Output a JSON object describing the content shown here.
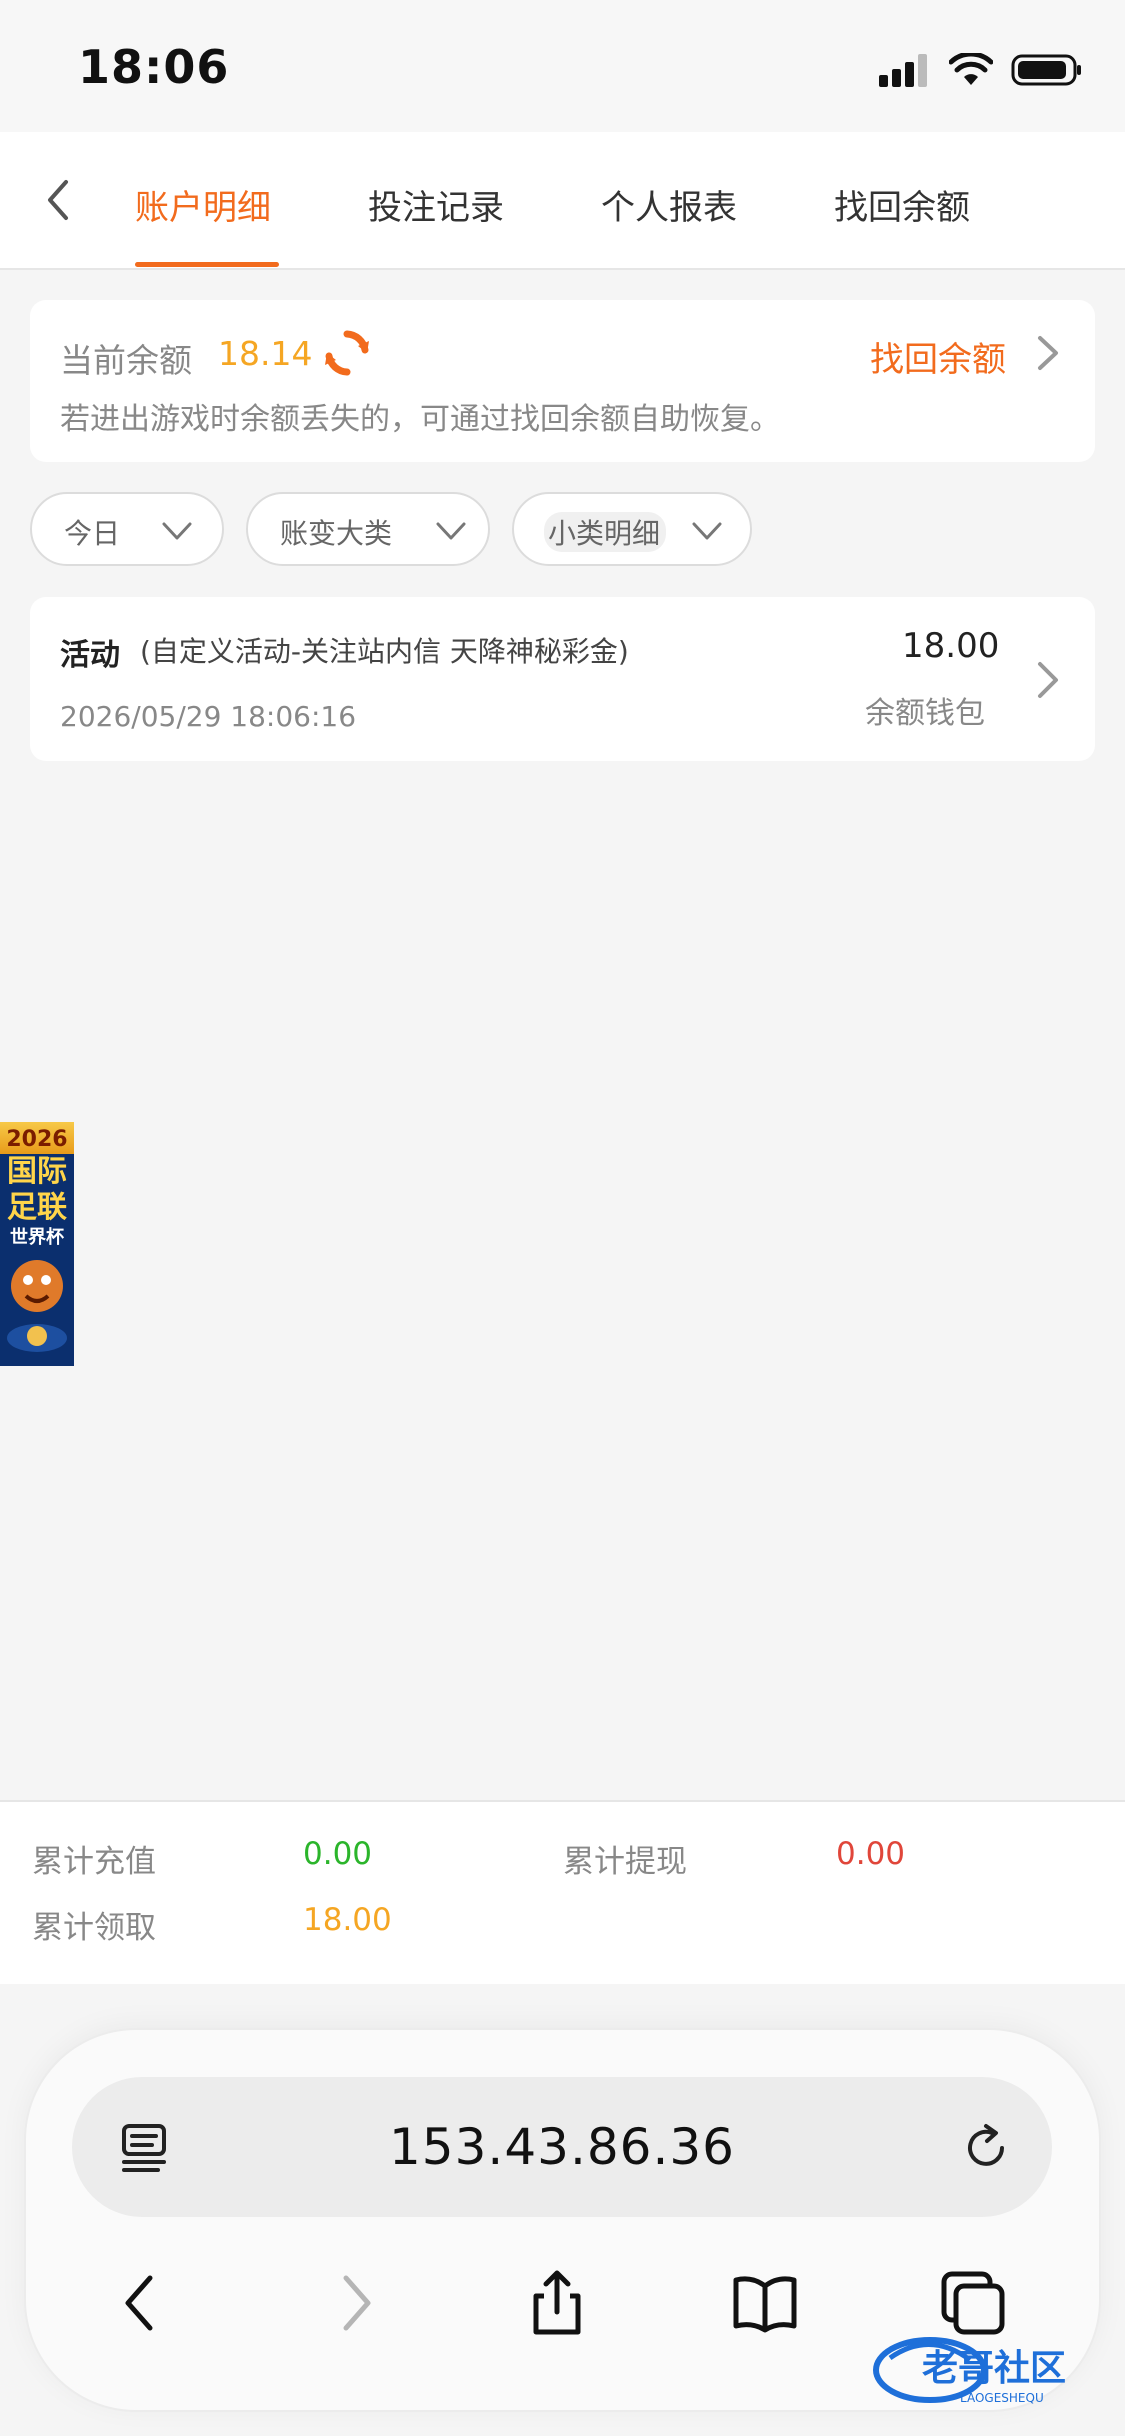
{
  "status_bar": {
    "time": "18:06"
  },
  "tabs": {
    "items": [
      {
        "label": "账户明细",
        "active": true
      },
      {
        "label": "投注记录",
        "active": false
      },
      {
        "label": "个人报表",
        "active": false
      },
      {
        "label": "找回余额",
        "active": false
      }
    ]
  },
  "balance": {
    "label": "当前余额",
    "value": "18.14",
    "recover_link": "找回余额",
    "hint": "若进出游戏时余额丢失的，可通过找回余额自助恢复。"
  },
  "filters": {
    "date": "今日",
    "category": "账变大类",
    "subcategory": "小类明细"
  },
  "records": [
    {
      "type": "活动",
      "desc": "(自定义活动-关注站内信 天降神秘彩金)",
      "date": "2026/05/29 18:06:16",
      "amount": "18.00",
      "wallet": "余额钱包"
    }
  ],
  "promo": {
    "lines": [
      "2026",
      "国际",
      "足联",
      "世界杯"
    ]
  },
  "summary": {
    "recharge_label": "累计充值",
    "recharge_value": "0.00",
    "withdraw_label": "累计提现",
    "withdraw_value": "0.00",
    "claim_label": "累计领取",
    "claim_value": "18.00"
  },
  "browser": {
    "url": "153.43.86.36"
  },
  "watermark": {
    "text": "老哥社区",
    "subtext": "LAOGESHEQU"
  },
  "colors": {
    "accent": "#f26b1d",
    "balance": "#f5a623",
    "green": "#2bb52b",
    "red": "#e0463a"
  }
}
